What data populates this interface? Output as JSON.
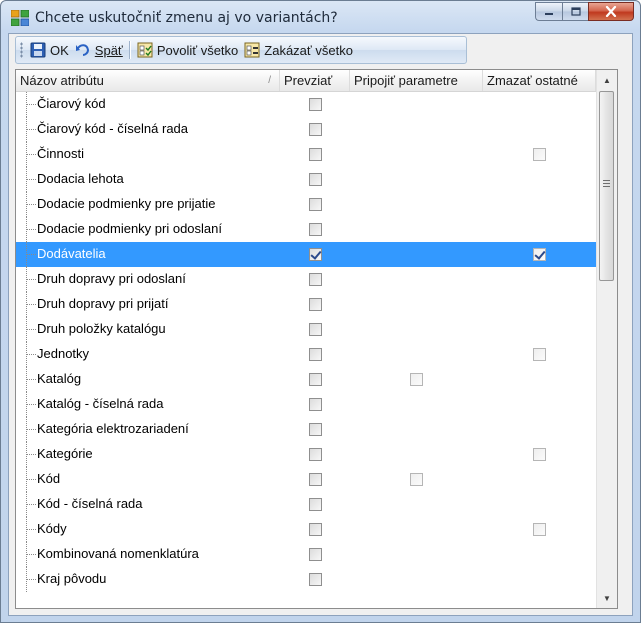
{
  "window": {
    "title": "Chcete uskutočniť zmenu aj vo variantách?",
    "icon": "variants-dialog-icon",
    "controls": {
      "minimize": "minimize-icon",
      "maximize": "maximize-icon",
      "close": "close-icon"
    }
  },
  "toolbar": {
    "ok_label": "OK",
    "back_label": "Späť",
    "allow_all_label": "Povoliť všetko",
    "forbid_all_label": "Zakázať všetko"
  },
  "grid": {
    "columns": [
      "Názov atribútu",
      "Prevziať",
      "Pripojiť parametre",
      "Zmazať ostatné"
    ],
    "rows": [
      {
        "name": "Čiarový kód",
        "prevziat": false,
        "pripojit": null,
        "zmazat": null
      },
      {
        "name": "Čiarový kód - číselná rada",
        "prevziat": false,
        "pripojit": null,
        "zmazat": null
      },
      {
        "name": "Činnosti",
        "prevziat": false,
        "pripojit": null,
        "zmazat": false
      },
      {
        "name": "Dodacia lehota",
        "prevziat": false,
        "pripojit": null,
        "zmazat": null
      },
      {
        "name": "Dodacie podmienky pre prijatie",
        "prevziat": false,
        "pripojit": null,
        "zmazat": null
      },
      {
        "name": "Dodacie podmienky pri odoslaní",
        "prevziat": false,
        "pripojit": null,
        "zmazat": null
      },
      {
        "name": "Dodávatelia",
        "prevziat": true,
        "pripojit": null,
        "zmazat": true,
        "selected": true
      },
      {
        "name": "Druh dopravy pri odoslaní",
        "prevziat": false,
        "pripojit": null,
        "zmazat": null
      },
      {
        "name": "Druh dopravy pri prijatí",
        "prevziat": false,
        "pripojit": null,
        "zmazat": null
      },
      {
        "name": "Druh položky katalógu",
        "prevziat": false,
        "pripojit": null,
        "zmazat": null
      },
      {
        "name": "Jednotky",
        "prevziat": false,
        "pripojit": null,
        "zmazat": false
      },
      {
        "name": "Katalóg",
        "prevziat": false,
        "pripojit": false,
        "zmazat": null
      },
      {
        "name": "Katalóg - číselná rada",
        "prevziat": false,
        "pripojit": null,
        "zmazat": null
      },
      {
        "name": "Kategória elektrozariadení",
        "prevziat": false,
        "pripojit": null,
        "zmazat": null
      },
      {
        "name": "Kategórie",
        "prevziat": false,
        "pripojit": null,
        "zmazat": false
      },
      {
        "name": "Kód",
        "prevziat": false,
        "pripojit": false,
        "zmazat": null
      },
      {
        "name": "Kód - číselná rada",
        "prevziat": false,
        "pripojit": null,
        "zmazat": null
      },
      {
        "name": "Kódy",
        "prevziat": false,
        "pripojit": null,
        "zmazat": false
      },
      {
        "name": "Kombinovaná nomenklatúra",
        "prevziat": false,
        "pripojit": null,
        "zmazat": null
      },
      {
        "name": "Kraj pôvodu",
        "prevziat": false,
        "pripojit": null,
        "zmazat": null
      }
    ]
  },
  "colors": {
    "selection": "#3399ff",
    "close_button": "#c0391f"
  }
}
